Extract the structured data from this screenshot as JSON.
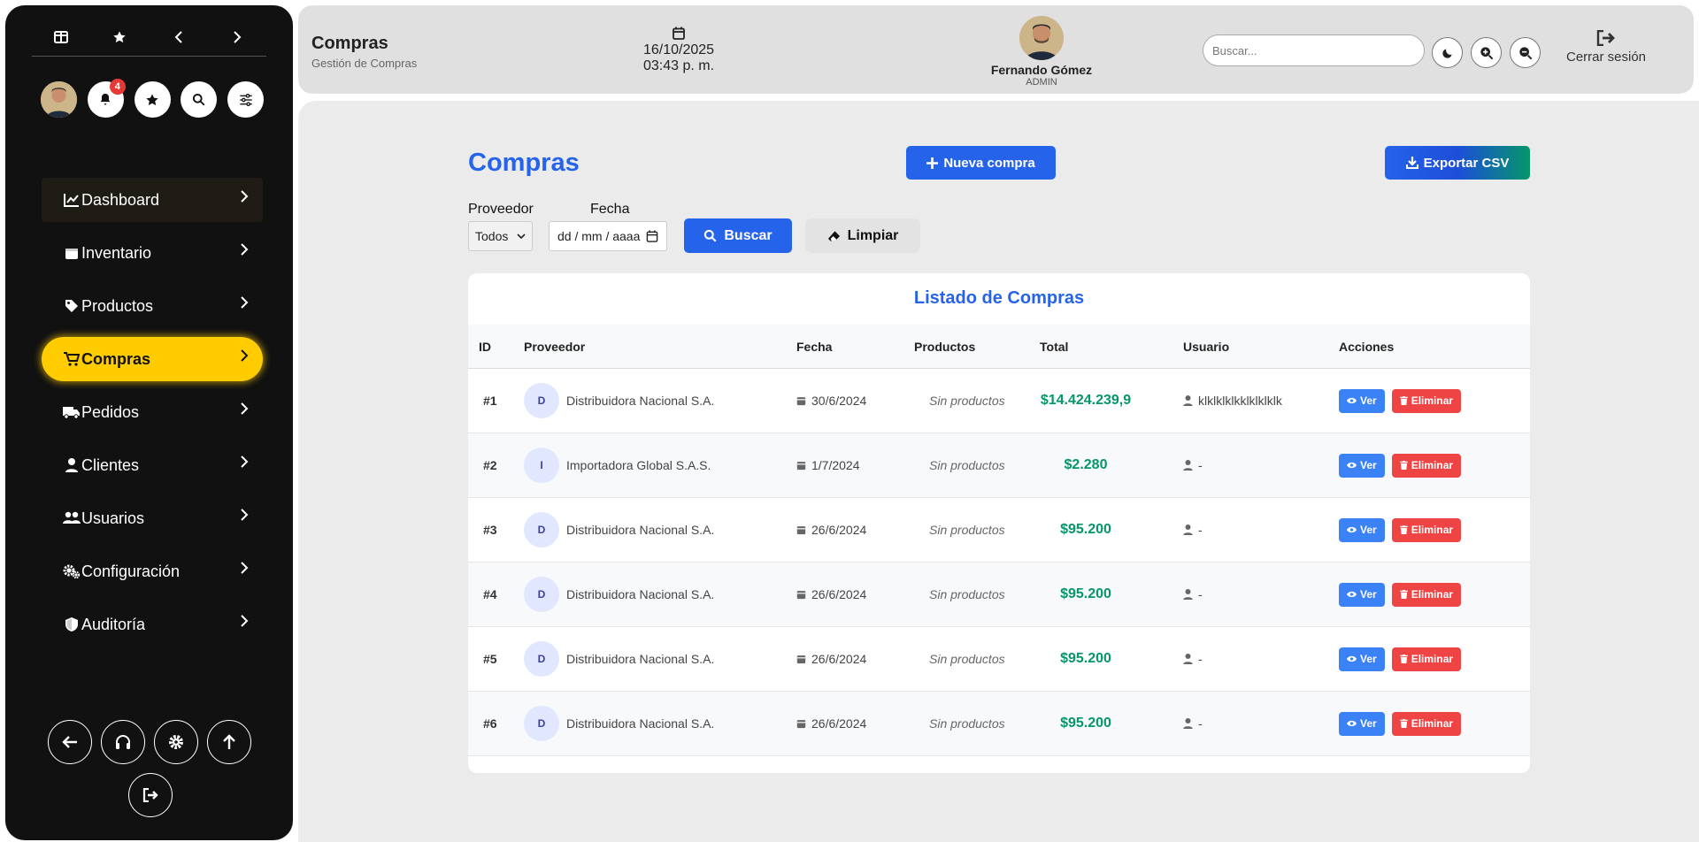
{
  "header": {
    "title": "Compras",
    "subtitle": "Gestión de Compras",
    "date": "16/10/2025",
    "time": "03:43 p. m.",
    "user_name": "Fernando Gómez",
    "user_role": "ADMIN",
    "search_placeholder": "Buscar...",
    "logout_label": "Cerrar sesión"
  },
  "sidebar": {
    "notification_count": "4",
    "items": [
      {
        "label": "Dashboard",
        "icon": "chart-line-icon"
      },
      {
        "label": "Inventario",
        "icon": "warehouse-icon"
      },
      {
        "label": "Productos",
        "icon": "tag-icon"
      },
      {
        "label": "Compras",
        "icon": "cart-icon"
      },
      {
        "label": "Pedidos",
        "icon": "truck-icon"
      },
      {
        "label": "Clientes",
        "icon": "user-icon"
      },
      {
        "label": "Usuarios",
        "icon": "users-icon"
      },
      {
        "label": "Configuración",
        "icon": "gears-icon"
      },
      {
        "label": "Auditoría",
        "icon": "shield-icon"
      }
    ],
    "active_item": "Compras",
    "accent_color": "#ffcc00"
  },
  "main": {
    "title": "Compras",
    "new_button": "Nueva compra",
    "export_button": "Exportar CSV",
    "filters": {
      "proveedor_label": "Proveedor",
      "proveedor_value": "Todos",
      "fecha_label": "Fecha",
      "fecha_placeholder": "dd / mm / aaaa",
      "search_button": "Buscar",
      "clear_button": "Limpiar"
    },
    "table": {
      "title": "Listado de Compras",
      "columns": [
        "ID",
        "Proveedor",
        "Fecha",
        "Productos",
        "Total",
        "Usuario",
        "Acciones"
      ],
      "rows": [
        {
          "id": "#1",
          "initial": "D",
          "proveedor": "Distribuidora Nacional S.A.",
          "fecha": "30/6/2024",
          "productos": "Sin productos",
          "total": "$14.424.239,9",
          "usuario": "klklklklkklklklklk"
        },
        {
          "id": "#2",
          "initial": "I",
          "proveedor": "Importadora Global S.A.S.",
          "fecha": "1/7/2024",
          "productos": "Sin productos",
          "total": "$2.280",
          "usuario": "-"
        },
        {
          "id": "#3",
          "initial": "D",
          "proveedor": "Distribuidora Nacional S.A.",
          "fecha": "26/6/2024",
          "productos": "Sin productos",
          "total": "$95.200",
          "usuario": "-"
        },
        {
          "id": "#4",
          "initial": "D",
          "proveedor": "Distribuidora Nacional S.A.",
          "fecha": "26/6/2024",
          "productos": "Sin productos",
          "total": "$95.200",
          "usuario": "-"
        },
        {
          "id": "#5",
          "initial": "D",
          "proveedor": "Distribuidora Nacional S.A.",
          "fecha": "26/6/2024",
          "productos": "Sin productos",
          "total": "$95.200",
          "usuario": "-"
        },
        {
          "id": "#6",
          "initial": "D",
          "proveedor": "Distribuidora Nacional S.A.",
          "fecha": "26/6/2024",
          "productos": "Sin productos",
          "total": "$95.200",
          "usuario": "-"
        }
      ],
      "view_label": "Ver",
      "delete_label": "Eliminar"
    }
  },
  "colors": {
    "primary": "#2563eb",
    "success": "#059669",
    "danger": "#ef4444",
    "accent": "#ffcc00"
  }
}
